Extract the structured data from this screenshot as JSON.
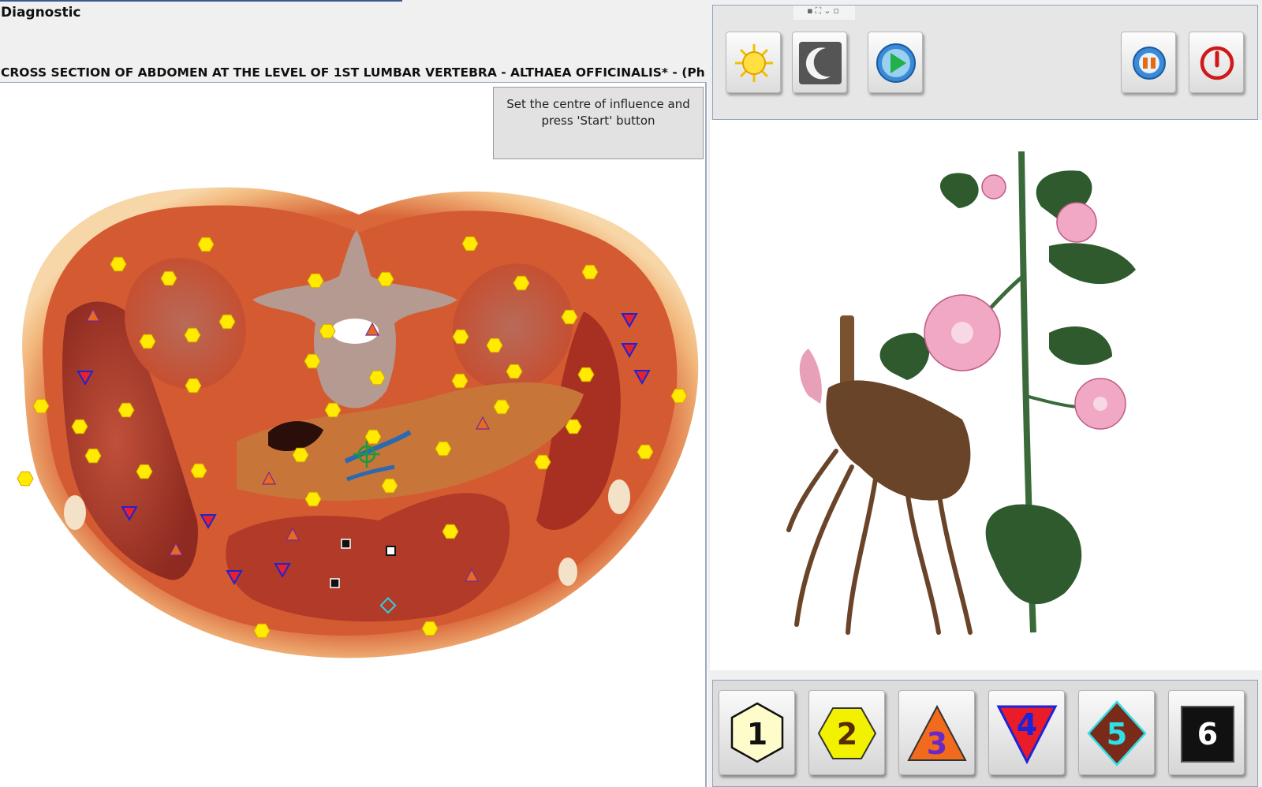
{
  "header": {
    "title": "Diagnostic",
    "section_title": "CROSS SECTION OF ABDOMEN AT THE LEVEL OF 1ST LUMBAR VERTEBRA - ALTHAEA  OFFICINALIS* - (Ph"
  },
  "hint": {
    "line1": "Set the centre of influence and",
    "line2": "press 'Start' button"
  },
  "toolbar": {
    "buttons": [
      {
        "name": "day-mode-button",
        "icon": "sun-icon"
      },
      {
        "name": "night-mode-button",
        "icon": "moon-icon"
      },
      {
        "name": "start-button",
        "icon": "play-icon"
      },
      {
        "name": "audio-button",
        "icon": "speaker-icon"
      },
      {
        "name": "power-button",
        "icon": "power-icon"
      }
    ]
  },
  "markers": {
    "buttons": [
      {
        "label": "1",
        "shape": "hexagon",
        "fill": "#fffccc",
        "text_color": "#111111"
      },
      {
        "label": "2",
        "shape": "hexagon",
        "fill": "#f2f200",
        "text_color": "#5a2a00"
      },
      {
        "label": "3",
        "shape": "triangle-up",
        "fill": "#f26b1d",
        "text_color": "#6a28c8"
      },
      {
        "label": "4",
        "shape": "triangle-down",
        "fill": "#ea1c2a",
        "text_color": "#1a24d8"
      },
      {
        "label": "5",
        "shape": "diamond",
        "fill": "#7a2a18",
        "text_color": "#2ee0e8"
      },
      {
        "label": "6",
        "shape": "square",
        "fill": "#111111",
        "text_color": "#ffffff"
      }
    ]
  },
  "colors": {
    "tissue": "#c8502a",
    "hexagon_marker": "#ffea00",
    "triangle_up_marker": "#e66a20",
    "triangle_down_marker": "#e8202a",
    "target": "#1a9a3a"
  }
}
